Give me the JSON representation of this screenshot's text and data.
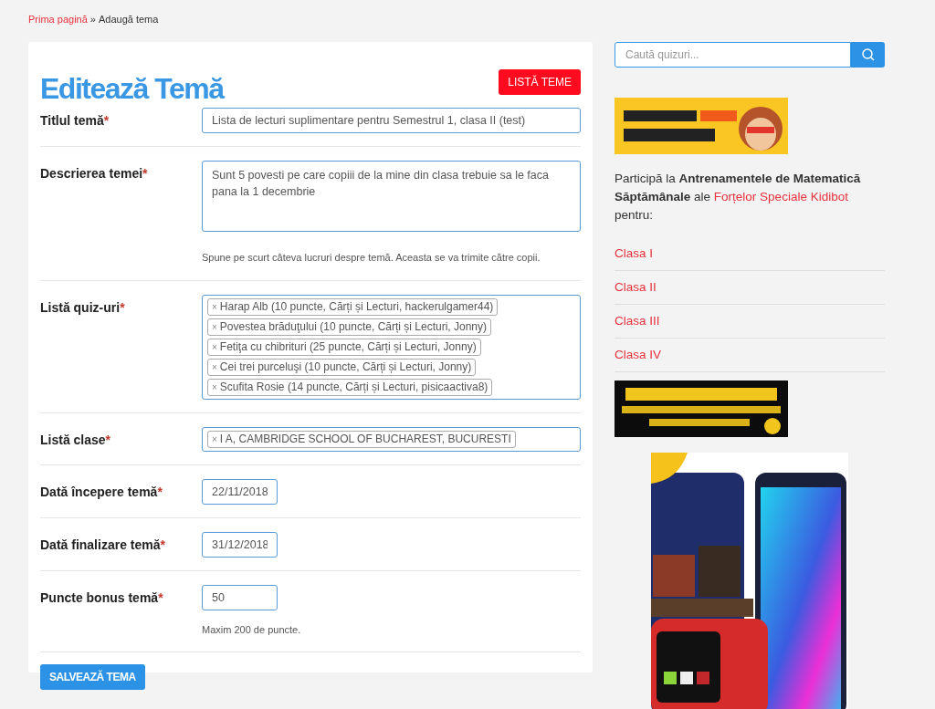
{
  "breadcrumb": {
    "link": "Prima pagină",
    "separator": "»",
    "current": "Adaugă tema"
  },
  "form": {
    "title": "Editează Temă",
    "list_button": "LISTĂ TEME",
    "fields": [
      {
        "kind": "text",
        "label": "Titlul temă",
        "required_mark": "*",
        "value": "Lista de lecturi suplimentare pentru Semestrul 1, clasa II (test)"
      },
      {
        "kind": "textarea",
        "label": "Descrierea temei",
        "required_mark": "*",
        "value": "Sunt 5 povesti pe care copiii de la mine din clasa trebuie sa le faca pana la 1 decembrie",
        "help": "Spune pe scurt câteva lucruri despre temă. Aceasta se va trimite către copii."
      },
      {
        "kind": "tags",
        "label": "Listă quiz-uri",
        "required_mark": "*",
        "tags": [
          {
            "remove": "×",
            "text": "Harap Alb (10 puncte, Cărți și Lecturi, hackerulgamer44)"
          },
          {
            "remove": "×",
            "text": "Povestea brăduţului (10 puncte, Cărți și Lecturi, Jonny)"
          },
          {
            "remove": "×",
            "text": "Fetiţa cu chibrituri (25 puncte, Cărți și Lecturi, Jonny)"
          },
          {
            "remove": "×",
            "text": "Cei trei purceluşi (10 puncte, Cărți și Lecturi, Jonny)"
          },
          {
            "remove": "×",
            "text": "Scufita Rosie (14 puncte, Cărți și Lecturi, pisicaactiva8)"
          }
        ]
      },
      {
        "kind": "tags",
        "label": "Listă clase",
        "required_mark": "*",
        "tags": [
          {
            "remove": "×",
            "text": "I A, CAMBRIDGE SCHOOL OF BUCHAREST, BUCURESTI"
          }
        ]
      },
      {
        "kind": "short",
        "label": "Dată începere temă",
        "required_mark": "*",
        "value": "22/11/2018"
      },
      {
        "kind": "short",
        "label": "Dată finalizare temă",
        "required_mark": "*",
        "value": "31/12/2018"
      },
      {
        "kind": "short",
        "label": "Puncte bonus temă",
        "required_mark": "*",
        "value": "50",
        "help": "Maxim 200 de puncte."
      }
    ],
    "submit": "SALVEAZĂ TEMA"
  },
  "sidebar": {
    "search": {
      "placeholder": "Caută quizuri..."
    },
    "banner_top": {
      "kind": "picture"
    },
    "promo": {
      "before": "Participă la **Antrenamentele de Matematică Săptămânale** ale",
      "link": "Forțelor Speciale Kidibot",
      "after": "pentru:"
    },
    "class_links": [
      "Clasa I",
      "Clasa II",
      "Clasa III",
      "Clasa IV"
    ],
    "banner_bottom": {
      "kind": "picture"
    },
    "product_ad": {
      "kind": "picture"
    }
  }
}
